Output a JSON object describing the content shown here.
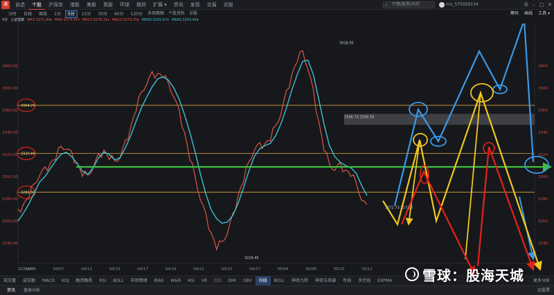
{
  "top_bar": {
    "app_icon": "tdx-logo-icon",
    "tabs": [
      "自选",
      "个股",
      "沪深京",
      "港股",
      "美股",
      "英股",
      "环球",
      "期货",
      "扩展 ▾",
      "资讯",
      "发现",
      "交易",
      "论股"
    ],
    "active_tab": 1,
    "search_placeholder": "行情/股票/问句",
    "user": "mx_575059134",
    "window_buttons": [
      "☰",
      "–",
      "□",
      "✕"
    ]
  },
  "toolbar": {
    "periods": [
      "分时",
      "日线",
      "周线",
      "1分",
      "5分",
      "15分",
      "30分",
      "60分",
      "120分"
    ],
    "active_period": 4,
    "links": [
      "多周期图",
      "个股资料",
      "诊股"
    ],
    "right_links": [
      "筹码",
      "画线",
      "工具 ▾"
    ]
  },
  "legend": {
    "items": [
      {
        "text": "5分",
        "color": "#c8ccd2"
      },
      {
        "text": "上证指数",
        "color": "#c8ccd2"
      },
      {
        "text": "MA3:3271.44▾",
        "color": "#e2584a"
      },
      {
        "text": "MA5:3273.91▾",
        "color": "#e2584a"
      },
      {
        "text": "MA10:3278.31▾",
        "color": "#e2584a"
      },
      {
        "text": "MA21:3279.25▾",
        "color": "#e2584a"
      },
      {
        "text": "MA55:3292.67▾",
        "color": "#3ec1d3"
      },
      {
        "text": "MA60:3254.42▾",
        "color": "#3ec1d3"
      }
    ]
  },
  "chart_data": {
    "type": "line",
    "title": "上证指数",
    "ylim": [
      3222,
      3438
    ],
    "y_ticks": [
      3240,
      3260,
      3280,
      3300,
      3320,
      3340,
      3360,
      3380,
      3400
    ],
    "y_tick_labels_left": [
      "3240.00",
      "3260.00",
      "3280.00",
      "3300.00",
      "3320.00",
      "3340.00",
      "3360.00",
      "3380.00",
      "3400.00"
    ],
    "y_tick_labels_right": [
      "3240",
      "3260",
      "3280",
      "3300",
      "3320",
      "3340",
      "3360",
      "3380",
      "3400"
    ],
    "x_tick_labels": [
      "2021/03",
      "04/04",
      "04/07",
      "04/11",
      "04/13",
      "04/17",
      "04/19",
      "04/21",
      "04/25",
      "04/27",
      "05/04",
      "05/08",
      "05/10",
      "05/12"
    ],
    "x_tick_positions": [
      0,
      4,
      13,
      22,
      31,
      40,
      49,
      58,
      67,
      76,
      85,
      94,
      103,
      112
    ],
    "series": [
      {
        "name": "MA55",
        "color": "#3ec1d3",
        "values": [
          3260,
          3267,
          3275,
          3285,
          3295,
          3300,
          3307,
          3314,
          3320,
          3322,
          3318,
          3312,
          3305,
          3302,
          3308,
          3317,
          3322,
          3320,
          3315,
          3317,
          3326,
          3337,
          3350,
          3362,
          3372,
          3381,
          3388,
          3390,
          3387,
          3380,
          3370,
          3356,
          3340,
          3322,
          3302,
          3284,
          3270,
          3262,
          3258,
          3259,
          3265,
          3276,
          3290,
          3305,
          3318,
          3325,
          3328,
          3330,
          3337,
          3348,
          3362,
          3378,
          3392,
          3404,
          3405,
          3392,
          3370,
          3347,
          3328,
          3318,
          3313,
          3310,
          3308,
          3303,
          3292,
          3283
        ]
      },
      {
        "name": "MA5",
        "color": "#e2584a",
        "values": [
          3268,
          3275,
          3283,
          3292,
          3302,
          3306,
          3312,
          3318,
          3326,
          3326,
          3320,
          3312,
          3303,
          3300,
          3309,
          3318,
          3324,
          3318,
          3313,
          3318,
          3330,
          3345,
          3362,
          3375,
          3385,
          3392,
          3393,
          3392,
          3383,
          3373,
          3358,
          3340,
          3318,
          3298,
          3280,
          3264,
          3249,
          3237,
          3240,
          3250,
          3264,
          3283,
          3298,
          3312,
          3325,
          3328,
          3330,
          3335,
          3345,
          3358,
          3375,
          3392,
          3406,
          3412,
          3398,
          3376,
          3350,
          3326,
          3310,
          3307,
          3310,
          3306,
          3303,
          3293,
          3280,
          3272
        ]
      }
    ],
    "horizontal_lines": [
      {
        "label": "3364.29",
        "value": 3364.29,
        "color": "#d9a63a"
      },
      {
        "label": "3320.89",
        "value": 3320.89,
        "color": "#d9a63a"
      },
      {
        "label": "3285.95",
        "value": 3285.95,
        "color": "#d9a63a"
      }
    ],
    "annotations": [
      {
        "text": "3418.95",
        "kind": "high"
      },
      {
        "text": "3229.45",
        "kind": "low"
      },
      {
        "text": "3346.72-3356.59",
        "kind": "band"
      },
      {
        "text": "3272.73-3272.8",
        "kind": "last"
      }
    ],
    "trend_line_color": "#3fbf3f",
    "path_colors": {
      "blue": "#3b9ae8",
      "yellow": "#f2c81f",
      "red": "#e6221b"
    }
  },
  "indicators": {
    "items": [
      "成交量",
      "成交额",
      "MACD",
      "KDJ",
      "融资融券",
      "RSI",
      "BOLL",
      "市场情绪",
      "BIAS",
      "W&R",
      "ASI",
      "VR",
      "CCI",
      "DMI",
      "OBV",
      "均线",
      "BOLL",
      "神奇九转",
      "神奇五线谱",
      "年线",
      "多空线",
      "EXPMA"
    ],
    "active": 15,
    "more": "更多分析"
  },
  "bottom_bar": {
    "tabs": [
      "资讯",
      "盘类分析"
    ],
    "right": "论股票"
  },
  "watermark": {
    "text": "雪球：股海天城",
    "logo": "xueqiu-logo-icon"
  }
}
